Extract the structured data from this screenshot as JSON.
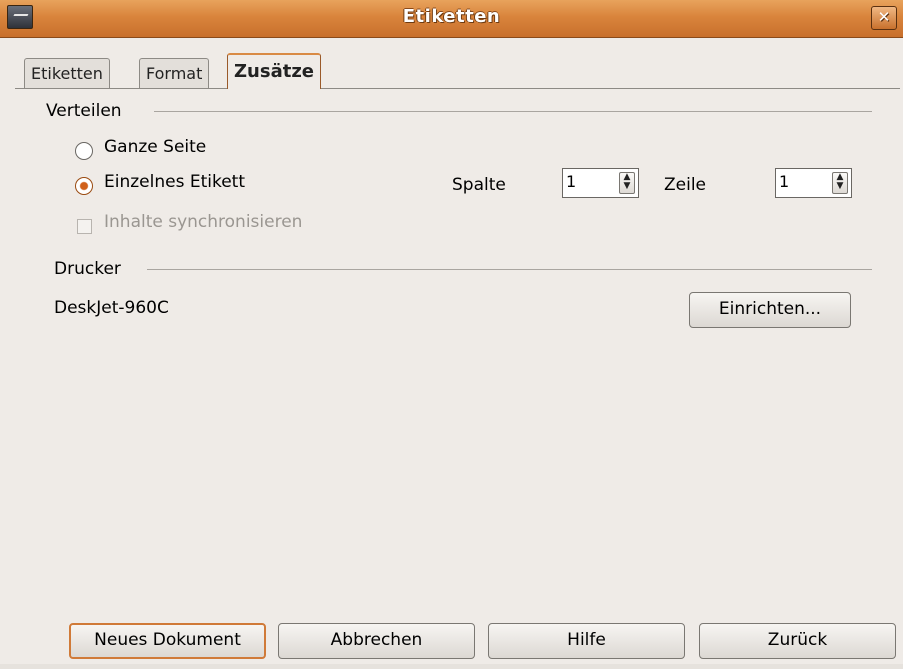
{
  "window": {
    "title": "Etiketten"
  },
  "tabs": [
    "Etiketten",
    "Format",
    "Zusätze"
  ],
  "distribute": {
    "heading": "Verteilen",
    "whole_page": "Ganze Seite",
    "single_label": "Einzelnes Etikett",
    "sync_contents": "Inhalte synchronisieren",
    "column_label": "Spalte",
    "column_value": "1",
    "row_label": "Zeile",
    "row_value": "1"
  },
  "printer": {
    "heading": "Drucker",
    "name": "DeskJet-960C",
    "setup_button": "Einrichten..."
  },
  "buttons": {
    "new_document": "Neues Dokument",
    "cancel": "Abbrechen",
    "help": "Hilfe",
    "back": "Zurück"
  },
  "colors": {
    "titlebar": "#d9843c",
    "accent": "#d07a38",
    "dialog_bg": "#efebe7"
  }
}
